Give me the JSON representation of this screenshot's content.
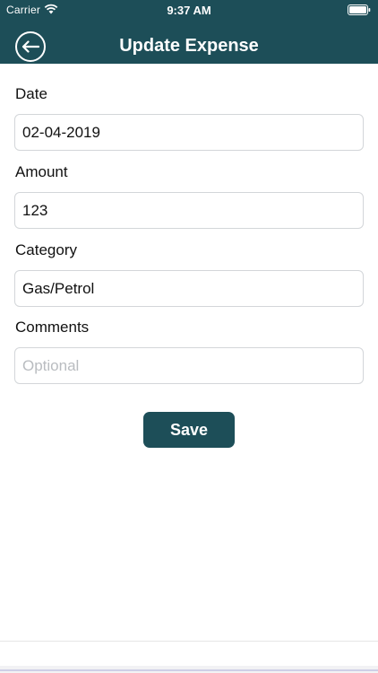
{
  "status_bar": {
    "carrier": "Carrier",
    "time": "9:37 AM",
    "wifi_icon": "wifi-icon",
    "battery_icon": "battery-icon"
  },
  "nav": {
    "title": "Update Expense",
    "back_icon": "back-arrow-circle-icon"
  },
  "form": {
    "date": {
      "label": "Date",
      "value": "02-04-2019",
      "placeholder": ""
    },
    "amount": {
      "label": "Amount",
      "value": "123",
      "placeholder": ""
    },
    "category": {
      "label": "Category",
      "value": "Gas/Petrol",
      "placeholder": ""
    },
    "comments": {
      "label": "Comments",
      "value": "",
      "placeholder": "Optional"
    },
    "save_label": "Save"
  },
  "colors": {
    "primary": "#1d4e58",
    "background": "#ffffff",
    "border": "#d3d6d9",
    "placeholder": "#b9bcc0"
  }
}
